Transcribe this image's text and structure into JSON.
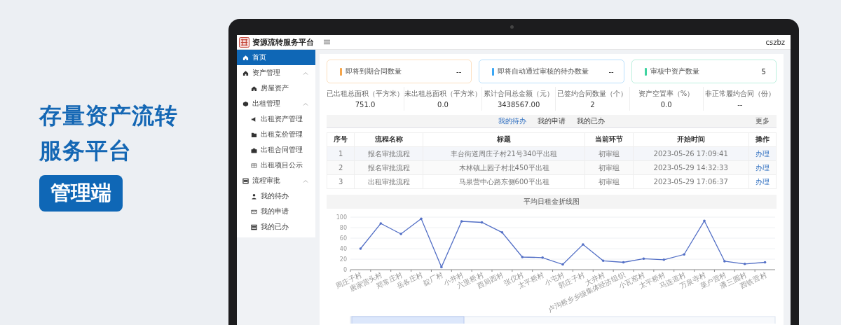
{
  "banner": {
    "title_lines": [
      "存量资产流转",
      "服务平台"
    ],
    "badge": "管理端"
  },
  "topbar": {
    "title": "资源流转服务平台",
    "user": "cszbz"
  },
  "sidebar": {
    "items": [
      {
        "label": "首页",
        "selected": true
      },
      {
        "label": "资产管理",
        "selected": false,
        "expanded": true,
        "children": [
          {
            "label": "房屋资产",
            "selected": false
          }
        ]
      },
      {
        "label": "出租管理",
        "selected": false,
        "expanded": true,
        "children": [
          {
            "label": "出租资产管理",
            "selected": false
          },
          {
            "label": "出租竞价管理",
            "selected": false
          },
          {
            "label": "出租合同管理",
            "selected": false
          },
          {
            "label": "出租项目公示",
            "selected": false
          }
        ]
      },
      {
        "label": "流程审批",
        "selected": false,
        "expanded": true,
        "children": [
          {
            "label": "我的待办",
            "selected": false
          },
          {
            "label": "我的申请",
            "selected": false
          },
          {
            "label": "我的已办",
            "selected": false
          }
        ]
      }
    ]
  },
  "cards": [
    {
      "label": "即将到期合同数量",
      "value": "--",
      "color": "#f5a54a"
    },
    {
      "label": "即将自动通过审核的待办数量",
      "value": "--",
      "color": "#3ba7f5"
    },
    {
      "label": "审核中资产数量",
      "value": "5",
      "color": "#3fd3a0"
    }
  ],
  "stats": [
    {
      "label": "已出租总面积（平方米）",
      "value": "751.0"
    },
    {
      "label": "未出租总面积（平方米）",
      "value": "0.0"
    },
    {
      "label": "累计合同总金额（元）",
      "value": "3438567.00"
    },
    {
      "label": "已签约合同数量（个）",
      "value": "2"
    },
    {
      "label": "资产空置率（%）",
      "value": "0.0"
    },
    {
      "label": "非正常履约合同（份）",
      "value": "--"
    }
  ],
  "tasks": {
    "tabs": [
      {
        "label": "我的待办",
        "selected": true
      },
      {
        "label": "我的申请",
        "selected": false
      },
      {
        "label": "我的已办",
        "selected": false
      }
    ],
    "more": "更多",
    "columns": [
      "序号",
      "流程名称",
      "标题",
      "当前环节",
      "开始时间",
      "操作"
    ],
    "rows": [
      {
        "cells": [
          "1",
          "报名审批流程",
          "丰台街道周庄子村21号340平出租",
          "初审组",
          "2023-05-26 17:09:41"
        ],
        "action": "办理"
      },
      {
        "cells": [
          "2",
          "报名审批流程",
          "木林镇上园子村北450平出租",
          "初审组",
          "2023-05-29 14:32:33"
        ],
        "action": "办理"
      },
      {
        "cells": [
          "3",
          "出租审批流程",
          "马泉营中心路东侧600平出租",
          "初审组",
          "2023-05-29 17:06:37"
        ],
        "action": "办理"
      }
    ]
  },
  "chart": {
    "title": "平均日租金折线图",
    "chart_data": {
      "type": "line",
      "categories": [
        "周庄子村",
        "唐家营头村",
        "郑常庄村",
        "岳各庄村",
        "靛厂村",
        "小井村",
        "六里桥村",
        "西局西村",
        "张仪村",
        "太平桥村",
        "小屯村",
        "郭庄子村",
        "大井村",
        "卢沟桥乡乡级集体经济组织",
        "小瓦窑村",
        "太平桥村",
        "马连道村",
        "万泉寺村",
        "菜户营村",
        "潘三圆村",
        "西铁营村"
      ],
      "grid": true,
      "series": [
        {
          "color": "#5470c6",
          "values": [
            40,
            88,
            68,
            97,
            5,
            92,
            90,
            71,
            24,
            23,
            10,
            48,
            17,
            14,
            21,
            19,
            29,
            93,
            16,
            11,
            14
          ]
        }
      ],
      "ylim": [
        0,
        100
      ],
      "yticks": [
        0,
        20,
        40,
        60,
        80,
        100
      ]
    }
  }
}
